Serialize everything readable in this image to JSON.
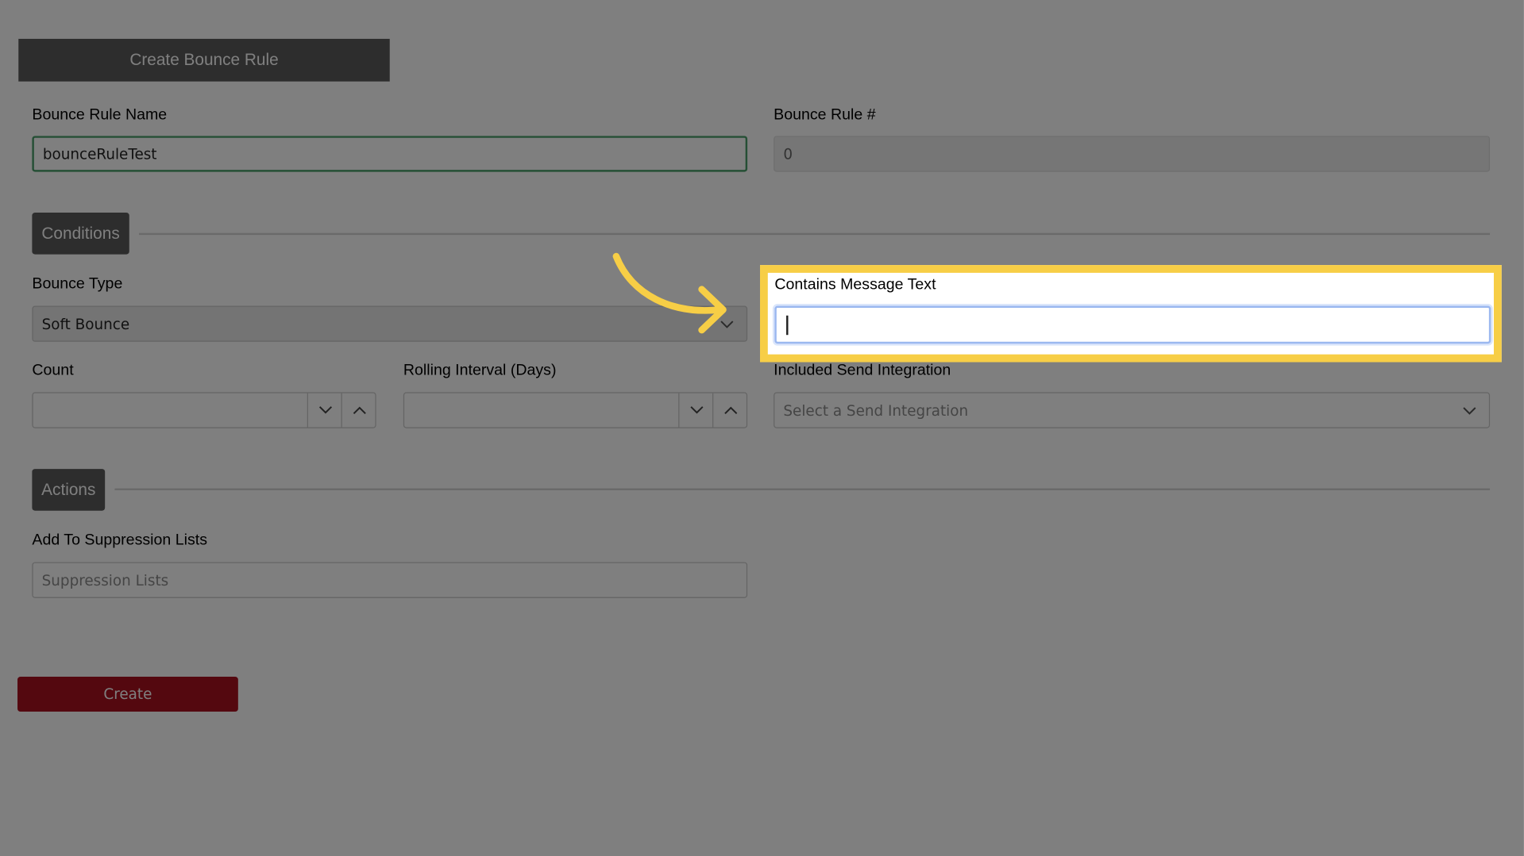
{
  "form": {
    "tab_title": "Create Bounce Rule",
    "rule_name": {
      "label": "Bounce Rule Name",
      "value": "bounceRuleTest"
    },
    "rule_number": {
      "label": "Bounce Rule #",
      "value": "0"
    },
    "conditions": {
      "section_label": "Conditions",
      "bounce_type": {
        "label": "Bounce Type",
        "selected": "Soft Bounce"
      },
      "contains_message_text": {
        "label": "Contains Message Text",
        "value": ""
      },
      "count": {
        "label": "Count"
      },
      "rolling_interval": {
        "label": "Rolling Interval (Days)"
      },
      "send_integration": {
        "label": "Included Send Integration",
        "placeholder": "Select a Send Integration"
      }
    },
    "actions": {
      "section_label": "Actions",
      "suppression_lists": {
        "label": "Add To Suppression Lists",
        "placeholder": "Suppression Lists"
      }
    },
    "create_label": "Create"
  },
  "colors": {
    "header_bg": "#5b5b5b",
    "create_button": "#a8101e",
    "highlight": "#f7ce46",
    "focus_green": "#4a9e6a",
    "overlay": "rgba(0,0,0,0.5)"
  },
  "icons": {
    "dropdown": "chevron-down-icon",
    "step_down": "chevron-down-icon",
    "step_up": "chevron-up-icon",
    "callout": "curved-arrow-icon"
  }
}
